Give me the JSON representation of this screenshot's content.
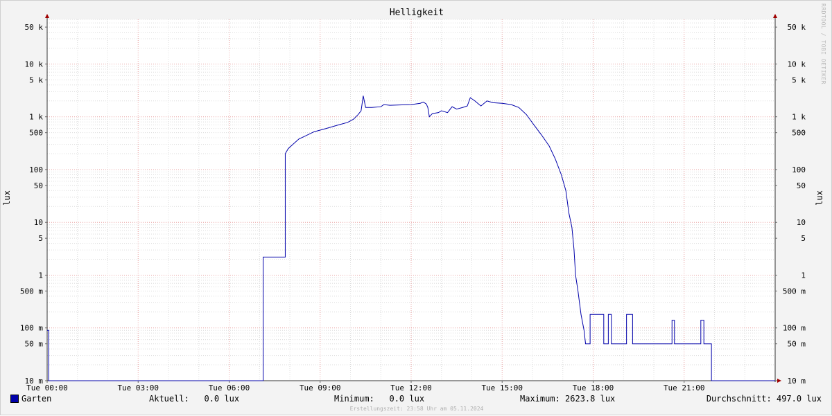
{
  "chart_data": {
    "type": "line",
    "title": "Helligkeit",
    "ylabel": "lux",
    "y_scale": "log",
    "ylim": [
      0.01,
      70000
    ],
    "xlim": [
      0,
      24
    ],
    "x_ticks": [
      {
        "x": 0,
        "label": "Tue 00:00"
      },
      {
        "x": 3,
        "label": "Tue 03:00"
      },
      {
        "x": 6,
        "label": "Tue 06:00"
      },
      {
        "x": 9,
        "label": "Tue 09:00"
      },
      {
        "x": 12,
        "label": "Tue 12:00"
      },
      {
        "x": 15,
        "label": "Tue 15:00"
      },
      {
        "x": 18,
        "label": "Tue 18:00"
      },
      {
        "x": 21,
        "label": "Tue 21:00"
      }
    ],
    "y_ticks": [
      {
        "v": 50000,
        "label": "50 k"
      },
      {
        "v": 10000,
        "label": "10 k"
      },
      {
        "v": 5000,
        "label": "5 k"
      },
      {
        "v": 1000,
        "label": "1 k"
      },
      {
        "v": 500,
        "label": "500"
      },
      {
        "v": 100,
        "label": "100"
      },
      {
        "v": 50,
        "label": "50"
      },
      {
        "v": 10,
        "label": "10"
      },
      {
        "v": 5,
        "label": "5"
      },
      {
        "v": 1,
        "label": "1"
      },
      {
        "v": 0.5,
        "label": "500 m"
      },
      {
        "v": 0.1,
        "label": "100 m"
      },
      {
        "v": 0.05,
        "label": "50 m"
      },
      {
        "v": 0.01,
        "label": "10 m"
      }
    ],
    "grid": true,
    "line_color": "#0000aa",
    "series": [
      {
        "name": "Garten",
        "points": [
          [
            0.0,
            0.09
          ],
          [
            0.05,
            0.09
          ],
          [
            0.05,
            0.01
          ],
          [
            7.12,
            0.01
          ],
          [
            7.12,
            2.2
          ],
          [
            7.85,
            2.2
          ],
          [
            7.85,
            200
          ],
          [
            7.95,
            250
          ],
          [
            8.1,
            300
          ],
          [
            8.3,
            380
          ],
          [
            8.5,
            430
          ],
          [
            8.8,
            520
          ],
          [
            9.2,
            600
          ],
          [
            9.6,
            700
          ],
          [
            9.9,
            780
          ],
          [
            10.1,
            900
          ],
          [
            10.25,
            1100
          ],
          [
            10.35,
            1300
          ],
          [
            10.42,
            2500
          ],
          [
            10.5,
            1500
          ],
          [
            10.7,
            1500
          ],
          [
            11.0,
            1550
          ],
          [
            11.1,
            1700
          ],
          [
            11.3,
            1650
          ],
          [
            11.7,
            1680
          ],
          [
            12.0,
            1700
          ],
          [
            12.3,
            1800
          ],
          [
            12.4,
            1900
          ],
          [
            12.5,
            1750
          ],
          [
            12.55,
            1500
          ],
          [
            12.6,
            1000
          ],
          [
            12.7,
            1150
          ],
          [
            12.9,
            1200
          ],
          [
            13.0,
            1300
          ],
          [
            13.2,
            1200
          ],
          [
            13.35,
            1550
          ],
          [
            13.5,
            1400
          ],
          [
            13.7,
            1500
          ],
          [
            13.85,
            1600
          ],
          [
            13.95,
            2300
          ],
          [
            14.1,
            2000
          ],
          [
            14.3,
            1600
          ],
          [
            14.5,
            2000
          ],
          [
            14.7,
            1850
          ],
          [
            15.0,
            1800
          ],
          [
            15.3,
            1700
          ],
          [
            15.55,
            1500
          ],
          [
            15.8,
            1100
          ],
          [
            16.05,
            700
          ],
          [
            16.3,
            450
          ],
          [
            16.55,
            280
          ],
          [
            16.75,
            160
          ],
          [
            16.95,
            80
          ],
          [
            17.1,
            40
          ],
          [
            17.2,
            15
          ],
          [
            17.3,
            8
          ],
          [
            17.37,
            3
          ],
          [
            17.42,
            1
          ],
          [
            17.5,
            0.5
          ],
          [
            17.6,
            0.18
          ],
          [
            17.7,
            0.09
          ],
          [
            17.75,
            0.05
          ],
          [
            17.9,
            0.05
          ],
          [
            17.9,
            0.18
          ],
          [
            18.35,
            0.18
          ],
          [
            18.35,
            0.05
          ],
          [
            18.5,
            0.05
          ],
          [
            18.5,
            0.18
          ],
          [
            18.6,
            0.18
          ],
          [
            18.6,
            0.05
          ],
          [
            19.1,
            0.05
          ],
          [
            19.1,
            0.18
          ],
          [
            19.3,
            0.18
          ],
          [
            19.3,
            0.05
          ],
          [
            20.6,
            0.05
          ],
          [
            20.6,
            0.14
          ],
          [
            20.68,
            0.14
          ],
          [
            20.68,
            0.05
          ],
          [
            21.55,
            0.05
          ],
          [
            21.55,
            0.14
          ],
          [
            21.65,
            0.14
          ],
          [
            21.65,
            0.05
          ],
          [
            21.9,
            0.05
          ],
          [
            21.9,
            0.01
          ],
          [
            24.0,
            0.01
          ]
        ]
      }
    ]
  },
  "legend": {
    "series_name": "Garten",
    "current_label": "Aktuell:",
    "current_value": "0.0 lux",
    "min_label": "Minimum:",
    "min_value": "0.0 lux",
    "max_label": "Maximum:",
    "max_value": "2623.8 lux",
    "avg_label": "Durchschnitt:",
    "avg_value": "497.0 lux"
  },
  "footer": "Erstellungszeit: 23:58 Uhr am 05.11.2024",
  "watermark": "RRDTOOL / TOBI OETIKER"
}
